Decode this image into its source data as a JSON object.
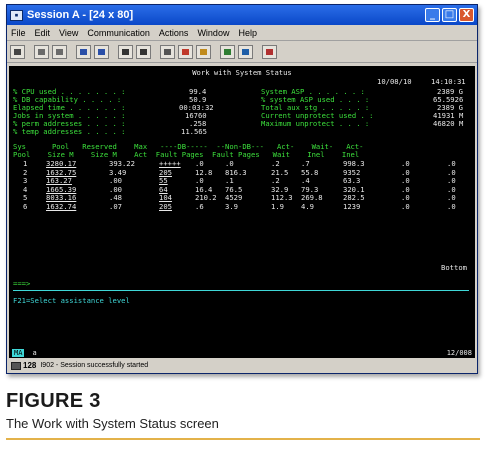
{
  "window": {
    "title": "Session A - [24 x 80]",
    "controls": {
      "minimize": "_",
      "maximize": "□",
      "close": "X"
    }
  },
  "menu": [
    "File",
    "Edit",
    "View",
    "Communication",
    "Actions",
    "Window",
    "Help"
  ],
  "toolbar": {
    "buttons": [
      "print-icon",
      "copy-icon",
      "paste-icon",
      "send-icon",
      "receive-icon",
      "display-icon",
      "keyboard-icon",
      "macro-icon",
      "color-icon",
      "record-icon",
      "play-icon",
      "help-icon",
      "stop-icon"
    ]
  },
  "screen": {
    "title": "Work with System Status",
    "date": "10/08/10",
    "time": "14:10:31",
    "left_stats": [
      {
        "label": "% CPU used . . . . . . . :",
        "value": "99.4"
      },
      {
        "label": "% DB capability . . . . :",
        "value": "50.9"
      },
      {
        "label": "Elapsed time . . . . . . :",
        "value": "00:03:32"
      },
      {
        "label": "Jobs in system . . . . . :",
        "value": "16760"
      },
      {
        "label": "% perm addresses . . . . :",
        "value": ".258"
      },
      {
        "label": "% temp addresses . . . . :",
        "value": "11.565"
      }
    ],
    "right_stats": [
      {
        "label": "System ASP . . . . . . :",
        "value": "2389 G"
      },
      {
        "label": "% system ASP used . . . :",
        "value": "65.5926"
      },
      {
        "label": "Total aux stg . . . . . :",
        "value": "2389 G"
      },
      {
        "label": "Current unprotect used . :",
        "value": "41931 M"
      },
      {
        "label": "Maximum unprotect . . . :",
        "value": "46820 M"
      }
    ],
    "col_header1": "Sys      Pool   Reserved    Max   ----DB-----  --Non-DB---   Act-    Wait-   Act-",
    "col_header2": "Pool    Size M    Size M    Act  Fault Pages  Fault Pages   Wait    Inel    Inel",
    "rows": [
      {
        "pool": "1",
        "size": "3280.17",
        "reserved": "393.22",
        "max": "+++++",
        "db_fault": ".0",
        "db_pages": ".0",
        "ndb_fault": ".2",
        "ndb_pages": ".7",
        "act_wait": "998.3",
        "wait_inel": ".0",
        "act_inel": ".0"
      },
      {
        "pool": "2",
        "size": "1632.75",
        "reserved": "3.49",
        "max": "205",
        "db_fault": "12.8",
        "db_pages": "816.3",
        "ndb_fault": "21.5",
        "ndb_pages": "55.8",
        "act_wait": "9352",
        "wait_inel": ".0",
        "act_inel": ".0"
      },
      {
        "pool": "3",
        "size": "163.27",
        "reserved": ".00",
        "max": "55",
        "db_fault": ".0",
        "db_pages": ".1",
        "ndb_fault": ".2",
        "ndb_pages": ".4",
        "act_wait": "63.3",
        "wait_inel": ".0",
        "act_inel": ".0"
      },
      {
        "pool": "4",
        "size": "1665.39",
        "reserved": ".00",
        "max": "64",
        "db_fault": "16.4",
        "db_pages": "76.5",
        "ndb_fault": "32.9",
        "ndb_pages": "79.3",
        "act_wait": "320.1",
        "wait_inel": ".0",
        "act_inel": ".0"
      },
      {
        "pool": "5",
        "size": "8033.16",
        "reserved": ".48",
        "max": "104",
        "db_fault": "210.2",
        "db_pages": "4529",
        "ndb_fault": "112.3",
        "ndb_pages": "269.8",
        "act_wait": "282.5",
        "wait_inel": ".0",
        "act_inel": ".0"
      },
      {
        "pool": "6",
        "size": "1632.74",
        "reserved": ".07",
        "max": "205",
        "db_fault": ".6",
        "db_pages": "3.9",
        "ndb_fault": "1.9",
        "ndb_pages": "4.9",
        "act_wait": "1239",
        "wait_inel": ".0",
        "act_inel": ".0"
      }
    ],
    "bottom_label": "Bottom",
    "command_prompt": "===>",
    "function_keys": "F21=Select assistance level"
  },
  "status": {
    "ma": "MA",
    "session": "a",
    "cursor": "12/008",
    "code": "128",
    "message": "I902 - Session successfully started"
  },
  "figure": {
    "label": "FIGURE 3",
    "caption": "The Work with System Status screen"
  },
  "colors": {
    "terminal_bg": "#000000",
    "terminal_green": "#3ce03c",
    "terminal_white": "#e8e8e8",
    "terminal_cyan": "#3fd7d7",
    "titlebar_blue": "#0a47c8",
    "caption_rule": "#e3b24a"
  }
}
